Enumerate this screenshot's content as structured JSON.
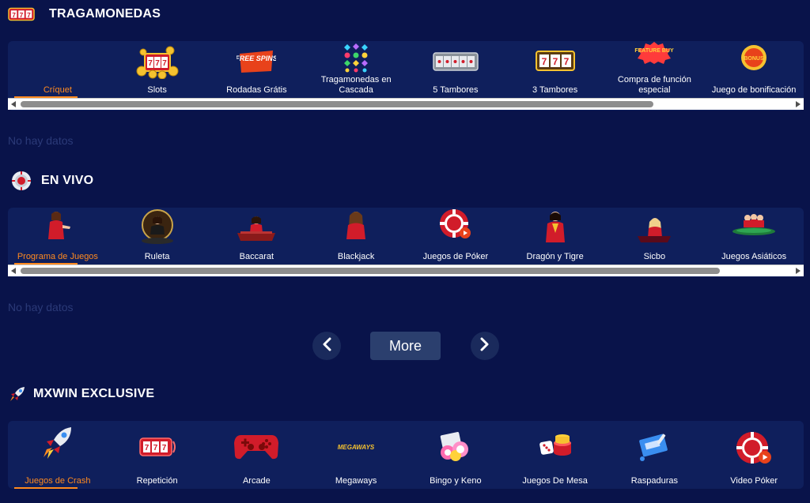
{
  "slots": {
    "title": "TRAGAMONEDAS",
    "icon": "slot-777-icon",
    "categories": [
      {
        "label": "Críquet",
        "icon": "cricket-icon",
        "active": true
      },
      {
        "label": "Slots",
        "icon": "slots-coins-icon"
      },
      {
        "label": "Rodadas Grátis",
        "icon": "free-spins-icon"
      },
      {
        "label": "Tragamonedas en Cascada",
        "icon": "gems-cascade-icon"
      },
      {
        "label": "5 Tambores",
        "icon": "five-reels-icon"
      },
      {
        "label": "3 Tambores",
        "icon": "three-reels-icon"
      },
      {
        "label": "Compra de función especial",
        "icon": "feature-buy-icon"
      },
      {
        "label": "Juego de bonificación",
        "icon": "bonus-icon"
      }
    ],
    "empty_text": "No hay datos",
    "scroll_fraction": 0.81,
    "free_spins_text": "FREE SPINS",
    "feature_buy_text": "FEATURE BUY",
    "bonus_text": "BONUS"
  },
  "live": {
    "title": "EN VIVO",
    "icon": "casino-chip-icon",
    "categories": [
      {
        "label": "Programa de Juegos",
        "icon": "game-show-host-icon",
        "active": true
      },
      {
        "label": "Ruleta",
        "icon": "roulette-dealer-icon"
      },
      {
        "label": "Baccarat",
        "icon": "baccarat-dealer-icon"
      },
      {
        "label": "Blackjack",
        "icon": "blackjack-dealer-icon"
      },
      {
        "label": "Juegos de Póker",
        "icon": "poker-chip-play-icon"
      },
      {
        "label": "Dragón y Tigre",
        "icon": "dragon-tiger-dealer-icon"
      },
      {
        "label": "Sicbo",
        "icon": "sicbo-dealer-icon"
      },
      {
        "label": "Juegos Asiáticos",
        "icon": "asian-games-table-icon"
      }
    ],
    "empty_text": "No hay datos",
    "scroll_fraction": 0.89
  },
  "pager": {
    "prev_icon": "chevron-left-icon",
    "more_label": "More",
    "next_icon": "chevron-right-icon"
  },
  "exclusive": {
    "title": "MXWIN EXCLUSIVE",
    "icon": "rocket-icon",
    "categories": [
      {
        "label": "Juegos de Crash",
        "icon": "rocket-crash-icon",
        "active": true
      },
      {
        "label": "Repetición",
        "icon": "replay-777-icon"
      },
      {
        "label": "Arcade",
        "icon": "gamepad-icon"
      },
      {
        "label": "Megaways",
        "icon": "megaways-logo-icon"
      },
      {
        "label": "Bingo y Keno",
        "icon": "bingo-balls-icon"
      },
      {
        "label": "Juegos De Mesa",
        "icon": "dice-chips-icon"
      },
      {
        "label": "Raspaduras",
        "icon": "scratch-card-icon"
      },
      {
        "label": "Video Póker",
        "icon": "poker-chip-play-icon"
      }
    ],
    "megaways_text": "MEGAWAYS"
  },
  "colors": {
    "background": "#09134a",
    "panel": "#0f1f5c",
    "accent": "#ff8a1f",
    "nodata": "#2b3a78"
  }
}
